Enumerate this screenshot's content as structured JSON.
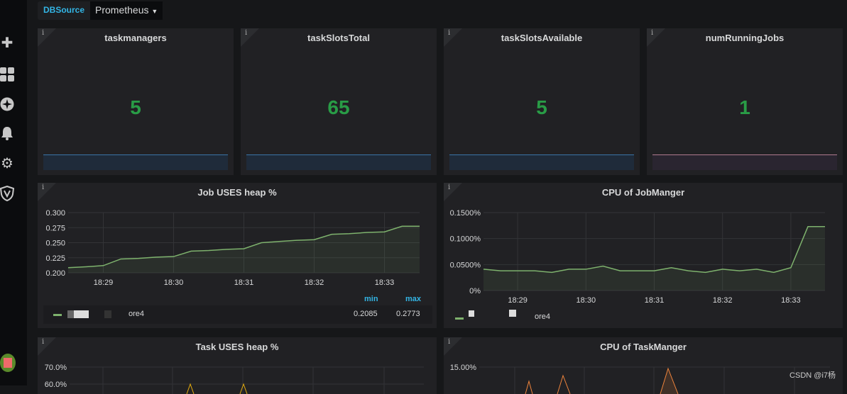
{
  "sidebar": {
    "icons": [
      "plus-icon",
      "dashboard-grid-icon",
      "compass-icon",
      "bell-icon",
      "gear-icon",
      "shield-icon",
      "avatar"
    ]
  },
  "toolbar": {
    "variable_label": "DBSource",
    "variable_value": "Prometheus"
  },
  "stats": [
    {
      "title": "taskmanagers",
      "value": "5"
    },
    {
      "title": "taskSlotsTotal",
      "value": "65"
    },
    {
      "title": "taskSlotsAvailable",
      "value": "5"
    },
    {
      "title": "numRunningJobs",
      "value": "1"
    }
  ],
  "colors": {
    "value": "#299c46",
    "series": "#7eb26d",
    "legend_header": "#33b5e5",
    "orange": "#ef843c",
    "yellow": "#e5ac0e"
  },
  "info_glyph": "i",
  "chart_data": [
    {
      "type": "area",
      "title": "Job USES heap %",
      "ylim": [
        0.2,
        0.3
      ],
      "yticks": [
        "0.200",
        "0.225",
        "0.250",
        "0.275",
        "0.300"
      ],
      "xticks": [
        "18:29",
        "18:30",
        "18:31",
        "18:32",
        "18:33"
      ],
      "xlim": [
        "18:28:30",
        "18:33:30"
      ],
      "x": [
        "18:28:30",
        "18:28:45",
        "18:29:00",
        "18:29:15",
        "18:29:30",
        "18:29:45",
        "18:30:00",
        "18:30:15",
        "18:30:30",
        "18:30:45",
        "18:31:00",
        "18:31:15",
        "18:31:30",
        "18:31:45",
        "18:32:00",
        "18:32:15",
        "18:32:30",
        "18:32:45",
        "18:33:00",
        "18:33:15",
        "18:33:30"
      ],
      "values": [
        0.2085,
        0.21,
        0.212,
        0.223,
        0.224,
        0.226,
        0.227,
        0.236,
        0.237,
        0.239,
        0.24,
        0.25,
        0.252,
        0.254,
        0.255,
        0.264,
        0.265,
        0.267,
        0.268,
        0.2773,
        0.2773
      ],
      "legend": {
        "min_label": "min",
        "max_label": "max",
        "series": "ore4",
        "min": "0.2085",
        "max": "0.2773"
      }
    },
    {
      "type": "area",
      "title": "CPU of JobManger",
      "ylim": [
        0,
        0.15
      ],
      "unit": "%",
      "yticks": [
        "0%",
        "0.0500%",
        "0.1000%",
        "0.1500%"
      ],
      "xticks": [
        "18:29",
        "18:30",
        "18:31",
        "18:32",
        "18:33"
      ],
      "xlim": [
        "18:28:30",
        "18:33:30"
      ],
      "x": [
        "18:28:30",
        "18:28:45",
        "18:29:00",
        "18:29:15",
        "18:29:30",
        "18:29:45",
        "18:30:00",
        "18:30:15",
        "18:30:30",
        "18:30:45",
        "18:31:00",
        "18:31:15",
        "18:31:30",
        "18:31:45",
        "18:32:00",
        "18:32:15",
        "18:32:30",
        "18:32:45",
        "18:33:00",
        "18:33:15",
        "18:33:30"
      ],
      "values": [
        0.041,
        0.038,
        0.038,
        0.038,
        0.035,
        0.041,
        0.041,
        0.047,
        0.038,
        0.038,
        0.038,
        0.044,
        0.038,
        0.035,
        0.041,
        0.038,
        0.041,
        0.035,
        0.044,
        0.123,
        0.123
      ],
      "legend": {
        "series": "ore4"
      }
    },
    {
      "type": "line",
      "title": "Task USES heap %",
      "yticks": [
        "70.0%",
        "60.0%"
      ]
    },
    {
      "type": "line",
      "title": "CPU of TaskManger",
      "yticks": [
        "15.00%"
      ]
    }
  ],
  "watermark": "CSDN @i7杨"
}
